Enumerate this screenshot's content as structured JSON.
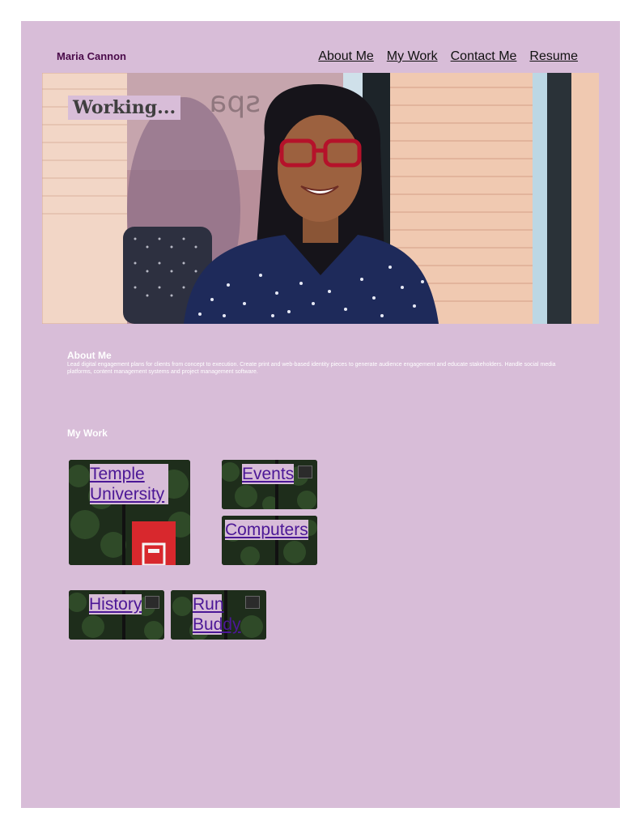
{
  "brand": "Maria Cannon",
  "nav": {
    "about": "About Me",
    "work": "My Work",
    "contact": "Contact Me",
    "resume": "Resume"
  },
  "hero": {
    "badge": "Working...",
    "window_text": "spa"
  },
  "about": {
    "title": "About Me",
    "body": "Lead digital engagement plans for clients from concept to execution. Create print and web-based identity pieces to generate audience engagement and educate stakeholders. Handle social media platforms, content management systems and project management software."
  },
  "work": {
    "title": "My Work",
    "tiles": {
      "temple": {
        "line1": "Temple",
        "line2": "University"
      },
      "events": "Events",
      "computers": "Computers",
      "history": "History",
      "runbuddy": {
        "line1": "Run",
        "line2": "Buddy"
      }
    }
  },
  "colors": {
    "page_bg": "#d8bdd8",
    "brand": "#4a0b4a",
    "link": "#4b1796",
    "banner_red": "#d8282d"
  }
}
